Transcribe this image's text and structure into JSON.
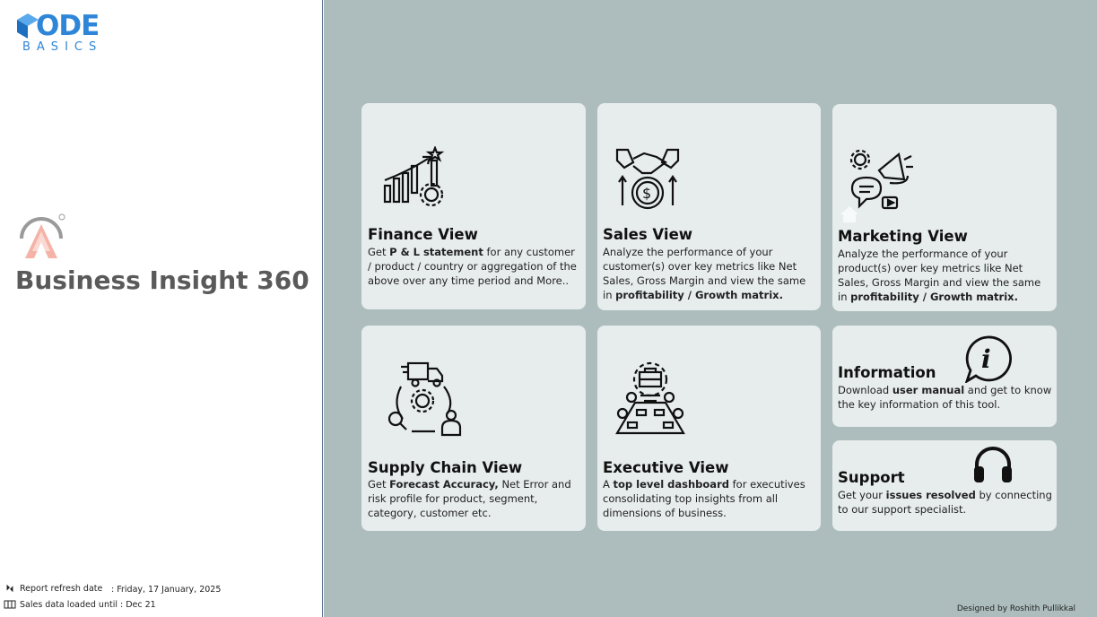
{
  "logo": {
    "code_text": "ODE",
    "basics_text": "BASICS"
  },
  "app": {
    "title": "Business Insight 360"
  },
  "footer": {
    "refresh_label": "Report refresh date",
    "refresh_value": ": Friday, 17 January, 2025",
    "loaded_label": "Sales data loaded until : Dec 21",
    "designed_by": "Designed by Roshith Pullikkal"
  },
  "cards": {
    "finance": {
      "title": "Finance View",
      "desc_pre": "Get ",
      "desc_bold": " P & L statement",
      "desc_post": " for any customer / product / country or aggregation of the above over any time period and More..",
      "icon": "growth-chart-icon"
    },
    "sales": {
      "title": "Sales View",
      "desc_pre": "Analyze the performance of your customer(s) over key metrics like Net Sales, Gross Margin and view the same in ",
      "desc_bold": "profitability / Growth matrix.",
      "icon": "handshake-dollar-icon"
    },
    "marketing": {
      "title": "Marketing View",
      "desc_pre": "Analyze the performance of your product(s) over key metrics like Net Sales, Gross Margin and view the same in ",
      "desc_bold": "profitability / Growth matrix.",
      "icon": "megaphone-icon"
    },
    "supply": {
      "title": "Supply Chain View",
      "desc_pre": "Get ",
      "desc_bold": "Forecast Accuracy,",
      "desc_post": " Net Error and risk profile for product, segment, category, customer etc.",
      "icon": "supply-chain-icon"
    },
    "exec": {
      "title": "Executive View",
      "desc_pre": "A ",
      "desc_bold": "top level dashboard",
      "desc_post": " for executives consolidating top insights from all dimensions of business.",
      "icon": "meeting-table-icon"
    },
    "info": {
      "title": "Information",
      "desc_pre": "Download ",
      "desc_bold": "user manual",
      "desc_post": " and get to know the key information of this tool.",
      "icon": "info-bubble-icon"
    },
    "support": {
      "title": "Support",
      "desc_pre": "Get your ",
      "desc_bold": "issues resolved",
      "desc_post": " by connecting to our support specialist.",
      "icon": "headphones-icon"
    }
  },
  "colors": {
    "brand_blue": "#2f86d8",
    "panel_bg": "#adbdbd",
    "card_bg": "#e7ecec",
    "title_gray": "#5a5a5a"
  }
}
